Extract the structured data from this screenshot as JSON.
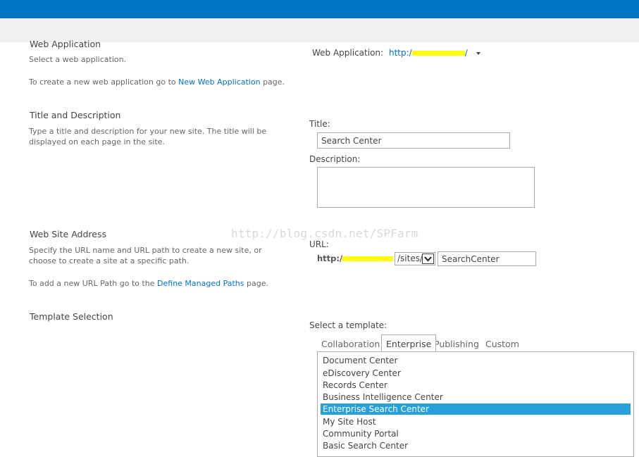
{
  "colors": {
    "topbar": "#0072c6",
    "link": "#0072c6",
    "selected": "#28a0dc",
    "redaction": "#ffff00"
  },
  "web_application": {
    "heading": "Web Application",
    "desc": "Select a web application.",
    "create_prefix": "To create a new web application go to ",
    "create_link": "New Web Application",
    "create_suffix": " page.",
    "field_label": "Web Application:",
    "value_prefix": "http:/",
    "value_suffix": "/"
  },
  "title_description": {
    "heading": "Title and Description",
    "desc": "Type a title and description for your new site. The title will be displayed on each page in the site.",
    "title_label": "Title:",
    "title_value": "Search Center",
    "description_label": "Description:",
    "description_value": ""
  },
  "web_site_address": {
    "heading": "Web Site Address",
    "desc": "Specify the URL name and URL path to create a new site, or choose to create a site at a specific path.",
    "add_prefix": "To add a new URL Path go to the ",
    "add_link": "Define Managed Paths",
    "add_suffix": " page.",
    "url_label": "URL:",
    "url_prefix": "http:/",
    "path_selected": "/sites/",
    "url_name": "SearchCenter"
  },
  "template_selection": {
    "heading": "Template Selection",
    "select_label": "Select a template:",
    "tabs": [
      "Collaboration",
      "Enterprise",
      "Publishing",
      "Custom"
    ],
    "active_tab": "Enterprise",
    "templates": [
      "Document Center",
      "eDiscovery Center",
      "Records Center",
      "Business Intelligence Center",
      "Enterprise Search Center",
      "My Site Host",
      "Community Portal",
      "Basic Search Center"
    ],
    "selected_template": "Enterprise Search Center"
  },
  "watermark": "http://blog.csdn.net/SPFarm"
}
